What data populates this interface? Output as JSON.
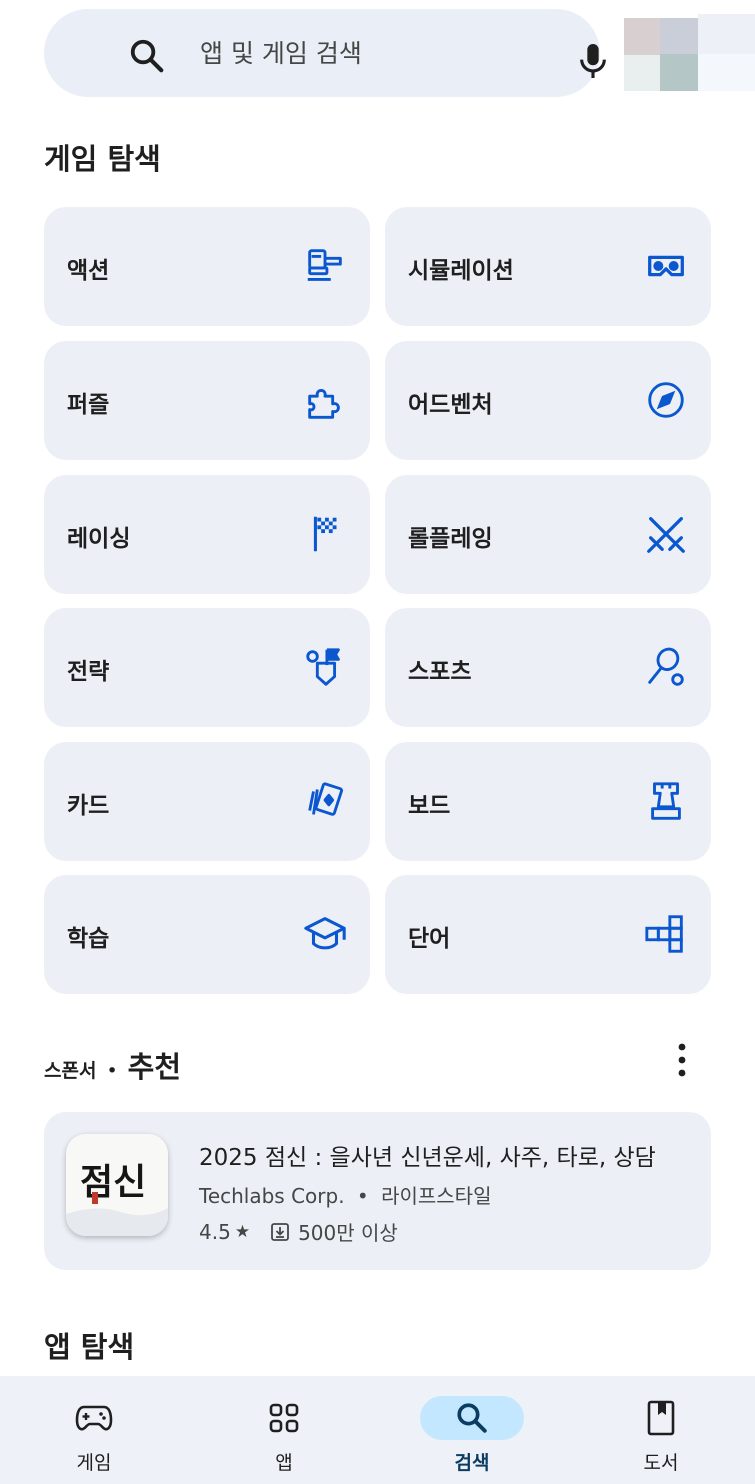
{
  "search": {
    "placeholder": "앱 및 게임 검색"
  },
  "game_explore": {
    "title": "게임 탐색",
    "categories": [
      {
        "label": "액션",
        "icon": "action-icon"
      },
      {
        "label": "시뮬레이션",
        "icon": "vr-headset-icon"
      },
      {
        "label": "퍼즐",
        "icon": "puzzle-icon"
      },
      {
        "label": "어드벤처",
        "icon": "compass-icon"
      },
      {
        "label": "레이싱",
        "icon": "checkered-flag-icon"
      },
      {
        "label": "롤플레잉",
        "icon": "crossed-swords-icon"
      },
      {
        "label": "전략",
        "icon": "strategy-flag-icon"
      },
      {
        "label": "스포츠",
        "icon": "racket-icon"
      },
      {
        "label": "카드",
        "icon": "cards-icon"
      },
      {
        "label": "보드",
        "icon": "chess-piece-icon"
      },
      {
        "label": "학습",
        "icon": "graduation-cap-icon"
      },
      {
        "label": "단어",
        "icon": "word-blocks-icon"
      }
    ]
  },
  "sponsored": {
    "sponsor_label": "스폰서",
    "dot": "•",
    "title": "추천",
    "app": {
      "name": "2025 점신 : 을사년 신년운세, 사주, 타로, 상담",
      "developer": "Techlabs Corp.",
      "separator": "•",
      "category": "라이프스타일",
      "rating": "4.5",
      "star": "★",
      "downloads": "500만 이상",
      "icon_text": "점신"
    }
  },
  "app_explore": {
    "title": "앱 탐색"
  },
  "bottom_nav": {
    "items": [
      {
        "label": "게임",
        "icon": "gamepad-icon",
        "active": false
      },
      {
        "label": "앱",
        "icon": "apps-grid-icon",
        "active": false
      },
      {
        "label": "검색",
        "icon": "search-icon",
        "active": true
      },
      {
        "label": "도서",
        "icon": "bookmark-book-icon",
        "active": false
      }
    ]
  },
  "colors": {
    "accent": "#0b57d0",
    "icon_blue": "#0b57d0",
    "card_bg": "#ecf0f6",
    "nav_active": "#c2e7ff"
  }
}
